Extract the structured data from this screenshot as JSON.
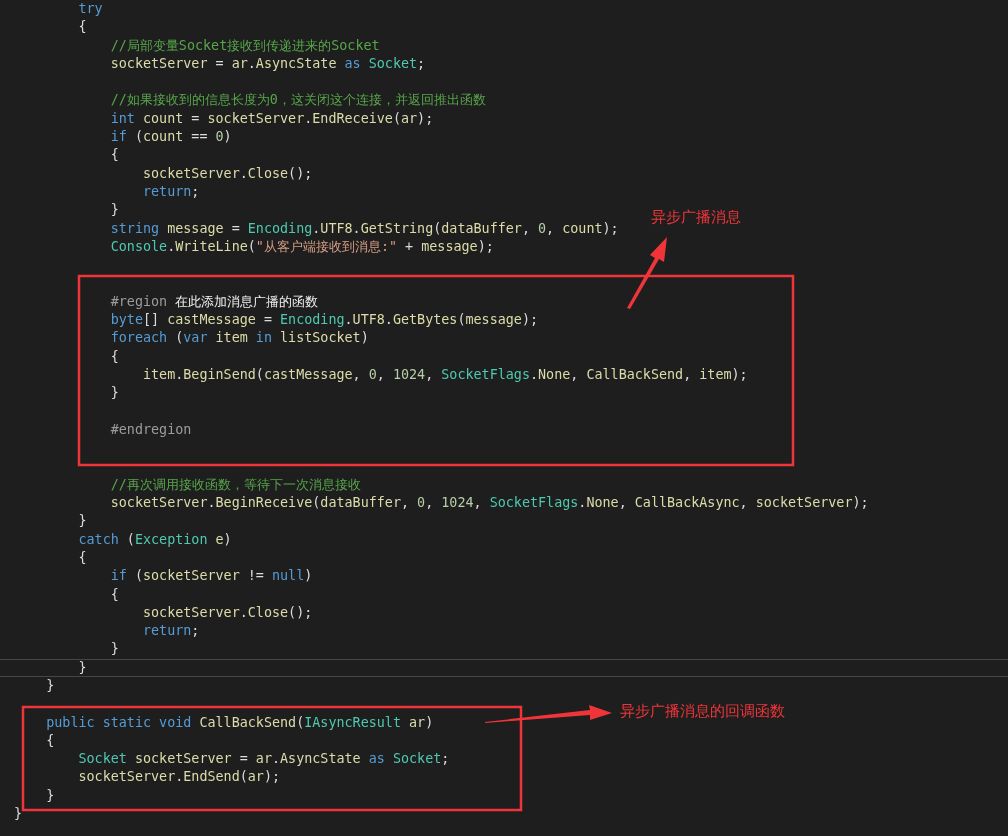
{
  "code_lines": [
    {
      "kind": "block",
      "children": [
        {
          "kind": "block",
          "children": [
            {
              "kind": "line",
              "current": false,
              "tokens": [
                {
                  "kind": "kw",
                  "text": "try"
                }
              ]
            },
            {
              "kind": "line",
              "current": false,
              "tokens": [
                {
                  "kind": "p",
                  "text": "{"
                }
              ]
            },
            {
              "kind": "block",
              "children": [
                {
                  "kind": "line",
                  "current": false,
                  "tokens": [
                    {
                      "kind": "com",
                      "text": "//局部变量Socket接收到传递进来的Socket"
                    }
                  ]
                },
                {
                  "kind": "line",
                  "current": false,
                  "tokens": [
                    {
                      "kind": "id",
                      "text": "socketServer"
                    },
                    {
                      "kind": "p",
                      "text": " = "
                    },
                    {
                      "kind": "id",
                      "text": "ar"
                    },
                    {
                      "kind": "p",
                      "text": "."
                    },
                    {
                      "kind": "id",
                      "text": "AsyncState"
                    },
                    {
                      "kind": "kw",
                      "text": " as "
                    },
                    {
                      "kind": "type",
                      "text": "Socket"
                    },
                    {
                      "kind": "p",
                      "text": ";"
                    }
                  ]
                },
                {
                  "kind": "blank"
                },
                {
                  "kind": "line",
                  "current": false,
                  "tokens": [
                    {
                      "kind": "com",
                      "text": "//如果接收到的信息长度为0，这关闭这个连接，并返回推出函数"
                    }
                  ]
                },
                {
                  "kind": "line",
                  "current": false,
                  "tokens": [
                    {
                      "kind": "kw",
                      "text": "int "
                    },
                    {
                      "kind": "id",
                      "text": "count"
                    },
                    {
                      "kind": "p",
                      "text": " = "
                    },
                    {
                      "kind": "id",
                      "text": "socketServer"
                    },
                    {
                      "kind": "p",
                      "text": "."
                    },
                    {
                      "kind": "id",
                      "text": "EndReceive"
                    },
                    {
                      "kind": "p",
                      "text": "("
                    },
                    {
                      "kind": "id",
                      "text": "ar"
                    },
                    {
                      "kind": "p",
                      "text": ");"
                    }
                  ]
                },
                {
                  "kind": "line",
                  "current": false,
                  "tokens": [
                    {
                      "kind": "kw",
                      "text": "if"
                    },
                    {
                      "kind": "p",
                      "text": " ("
                    },
                    {
                      "kind": "id",
                      "text": "count"
                    },
                    {
                      "kind": "p",
                      "text": " == "
                    },
                    {
                      "kind": "num",
                      "text": "0"
                    },
                    {
                      "kind": "p",
                      "text": ")"
                    }
                  ]
                },
                {
                  "kind": "line",
                  "current": false,
                  "tokens": [
                    {
                      "kind": "p",
                      "text": "{"
                    }
                  ]
                },
                {
                  "kind": "block",
                  "children": [
                    {
                      "kind": "line",
                      "current": false,
                      "tokens": [
                        {
                          "kind": "id",
                          "text": "socketServer"
                        },
                        {
                          "kind": "p",
                          "text": "."
                        },
                        {
                          "kind": "id",
                          "text": "Close"
                        },
                        {
                          "kind": "p",
                          "text": "();"
                        }
                      ]
                    },
                    {
                      "kind": "line",
                      "current": false,
                      "tokens": [
                        {
                          "kind": "kw",
                          "text": "return"
                        },
                        {
                          "kind": "p",
                          "text": ";"
                        }
                      ]
                    }
                  ]
                },
                {
                  "kind": "line",
                  "current": false,
                  "tokens": [
                    {
                      "kind": "p",
                      "text": "}"
                    }
                  ]
                },
                {
                  "kind": "line",
                  "current": false,
                  "tokens": [
                    {
                      "kind": "kw",
                      "text": "string "
                    },
                    {
                      "kind": "id",
                      "text": "message"
                    },
                    {
                      "kind": "p",
                      "text": " = "
                    },
                    {
                      "kind": "type",
                      "text": "Encoding"
                    },
                    {
                      "kind": "p",
                      "text": "."
                    },
                    {
                      "kind": "id",
                      "text": "UTF8"
                    },
                    {
                      "kind": "p",
                      "text": "."
                    },
                    {
                      "kind": "id",
                      "text": "GetString"
                    },
                    {
                      "kind": "p",
                      "text": "("
                    },
                    {
                      "kind": "id",
                      "text": "dataBuffer"
                    },
                    {
                      "kind": "p",
                      "text": ", "
                    },
                    {
                      "kind": "num",
                      "text": "0"
                    },
                    {
                      "kind": "p",
                      "text": ", "
                    },
                    {
                      "kind": "id",
                      "text": "count"
                    },
                    {
                      "kind": "p",
                      "text": ");"
                    }
                  ]
                },
                {
                  "kind": "line",
                  "current": false,
                  "tokens": [
                    {
                      "kind": "type",
                      "text": "Console"
                    },
                    {
                      "kind": "p",
                      "text": "."
                    },
                    {
                      "kind": "id",
                      "text": "WriteLine"
                    },
                    {
                      "kind": "p",
                      "text": "("
                    },
                    {
                      "kind": "str",
                      "text": "\"从客户端接收到消息:\""
                    },
                    {
                      "kind": "p",
                      "text": " + "
                    },
                    {
                      "kind": "id",
                      "text": "message"
                    },
                    {
                      "kind": "p",
                      "text": ");"
                    }
                  ]
                },
                {
                  "kind": "blank"
                },
                {
                  "kind": "blank"
                },
                {
                  "kind": "line",
                  "current": false,
                  "tokens": [
                    {
                      "kind": "dir",
                      "text": "#region "
                    },
                    {
                      "kind": "reg",
                      "text": "在此添加消息广播的函数"
                    }
                  ]
                },
                {
                  "kind": "line",
                  "current": false,
                  "tokens": [
                    {
                      "kind": "kw",
                      "text": "byte"
                    },
                    {
                      "kind": "p",
                      "text": "[] "
                    },
                    {
                      "kind": "id",
                      "text": "castMessage"
                    },
                    {
                      "kind": "p",
                      "text": " = "
                    },
                    {
                      "kind": "type",
                      "text": "Encoding"
                    },
                    {
                      "kind": "p",
                      "text": "."
                    },
                    {
                      "kind": "id",
                      "text": "UTF8"
                    },
                    {
                      "kind": "p",
                      "text": "."
                    },
                    {
                      "kind": "id",
                      "text": "GetBytes"
                    },
                    {
                      "kind": "p",
                      "text": "("
                    },
                    {
                      "kind": "id",
                      "text": "message"
                    },
                    {
                      "kind": "p",
                      "text": ");"
                    }
                  ]
                },
                {
                  "kind": "line",
                  "current": false,
                  "tokens": [
                    {
                      "kind": "kw",
                      "text": "foreach"
                    },
                    {
                      "kind": "p",
                      "text": " ("
                    },
                    {
                      "kind": "kw",
                      "text": "var "
                    },
                    {
                      "kind": "id",
                      "text": "item"
                    },
                    {
                      "kind": "kw",
                      "text": " in "
                    },
                    {
                      "kind": "id",
                      "text": "listSocket"
                    },
                    {
                      "kind": "p",
                      "text": ")"
                    }
                  ]
                },
                {
                  "kind": "line",
                  "current": false,
                  "tokens": [
                    {
                      "kind": "p",
                      "text": "{"
                    }
                  ]
                },
                {
                  "kind": "block",
                  "children": [
                    {
                      "kind": "line",
                      "current": false,
                      "tokens": [
                        {
                          "kind": "id",
                          "text": "item"
                        },
                        {
                          "kind": "p",
                          "text": "."
                        },
                        {
                          "kind": "id",
                          "text": "BeginSend"
                        },
                        {
                          "kind": "p",
                          "text": "("
                        },
                        {
                          "kind": "id",
                          "text": "castMessage"
                        },
                        {
                          "kind": "p",
                          "text": ", "
                        },
                        {
                          "kind": "num",
                          "text": "0"
                        },
                        {
                          "kind": "p",
                          "text": ", "
                        },
                        {
                          "kind": "num",
                          "text": "1024"
                        },
                        {
                          "kind": "p",
                          "text": ", "
                        },
                        {
                          "kind": "type",
                          "text": "SocketFlags"
                        },
                        {
                          "kind": "p",
                          "text": "."
                        },
                        {
                          "kind": "id",
                          "text": "None"
                        },
                        {
                          "kind": "p",
                          "text": ", "
                        },
                        {
                          "kind": "id",
                          "text": "CallBackSend"
                        },
                        {
                          "kind": "p",
                          "text": ", "
                        },
                        {
                          "kind": "id",
                          "text": "item"
                        },
                        {
                          "kind": "p",
                          "text": ");"
                        }
                      ]
                    }
                  ]
                },
                {
                  "kind": "line",
                  "current": false,
                  "tokens": [
                    {
                      "kind": "p",
                      "text": "}"
                    }
                  ]
                },
                {
                  "kind": "blank"
                },
                {
                  "kind": "line",
                  "current": false,
                  "tokens": [
                    {
                      "kind": "dir",
                      "text": "#endregion"
                    }
                  ]
                },
                {
                  "kind": "blank"
                },
                {
                  "kind": "blank"
                },
                {
                  "kind": "line",
                  "current": false,
                  "tokens": [
                    {
                      "kind": "com",
                      "text": "//再次调用接收函数，等待下一次消息接收"
                    }
                  ]
                },
                {
                  "kind": "line",
                  "current": false,
                  "tokens": [
                    {
                      "kind": "id",
                      "text": "socketServer"
                    },
                    {
                      "kind": "p",
                      "text": "."
                    },
                    {
                      "kind": "id",
                      "text": "BeginReceive"
                    },
                    {
                      "kind": "p",
                      "text": "("
                    },
                    {
                      "kind": "id",
                      "text": "dataBuffer"
                    },
                    {
                      "kind": "p",
                      "text": ", "
                    },
                    {
                      "kind": "num",
                      "text": "0"
                    },
                    {
                      "kind": "p",
                      "text": ", "
                    },
                    {
                      "kind": "num",
                      "text": "1024"
                    },
                    {
                      "kind": "p",
                      "text": ", "
                    },
                    {
                      "kind": "type",
                      "text": "SocketFlags"
                    },
                    {
                      "kind": "p",
                      "text": "."
                    },
                    {
                      "kind": "id",
                      "text": "None"
                    },
                    {
                      "kind": "p",
                      "text": ", "
                    },
                    {
                      "kind": "id",
                      "text": "CallBackAsync"
                    },
                    {
                      "kind": "p",
                      "text": ", "
                    },
                    {
                      "kind": "id",
                      "text": "socketServer"
                    },
                    {
                      "kind": "p",
                      "text": ");"
                    }
                  ]
                }
              ]
            },
            {
              "kind": "line",
              "current": false,
              "tokens": [
                {
                  "kind": "p",
                  "text": "}"
                }
              ]
            },
            {
              "kind": "line",
              "current": false,
              "tokens": [
                {
                  "kind": "kw",
                  "text": "catch"
                },
                {
                  "kind": "p",
                  "text": " ("
                },
                {
                  "kind": "type",
                  "text": "Exception"
                },
                {
                  "kind": "id",
                  "text": " e"
                },
                {
                  "kind": "p",
                  "text": ")"
                }
              ]
            },
            {
              "kind": "line",
              "current": false,
              "tokens": [
                {
                  "kind": "p",
                  "text": "{"
                }
              ]
            },
            {
              "kind": "block",
              "children": [
                {
                  "kind": "line",
                  "current": false,
                  "tokens": [
                    {
                      "kind": "kw",
                      "text": "if"
                    },
                    {
                      "kind": "p",
                      "text": " ("
                    },
                    {
                      "kind": "id",
                      "text": "socketServer"
                    },
                    {
                      "kind": "p",
                      "text": " != "
                    },
                    {
                      "kind": "kw",
                      "text": "null"
                    },
                    {
                      "kind": "p",
                      "text": ")"
                    }
                  ]
                },
                {
                  "kind": "line",
                  "current": false,
                  "tokens": [
                    {
                      "kind": "p",
                      "text": "{"
                    }
                  ]
                },
                {
                  "kind": "block",
                  "children": [
                    {
                      "kind": "line",
                      "current": false,
                      "tokens": [
                        {
                          "kind": "id",
                          "text": "socketServer"
                        },
                        {
                          "kind": "p",
                          "text": "."
                        },
                        {
                          "kind": "id",
                          "text": "Close"
                        },
                        {
                          "kind": "p",
                          "text": "();"
                        }
                      ]
                    },
                    {
                      "kind": "line",
                      "current": false,
                      "tokens": [
                        {
                          "kind": "kw",
                          "text": "return"
                        },
                        {
                          "kind": "p",
                          "text": ";"
                        }
                      ]
                    }
                  ]
                },
                {
                  "kind": "line",
                  "current": false,
                  "tokens": [
                    {
                      "kind": "p",
                      "text": "}"
                    }
                  ]
                }
              ]
            },
            {
              "kind": "line",
              "current": true,
              "tokens": [
                {
                  "kind": "p",
                  "text": "}"
                }
              ]
            }
          ]
        },
        {
          "kind": "line",
          "current": false,
          "tokens": [
            {
              "kind": "p",
              "text": "}"
            }
          ]
        },
        {
          "kind": "blank"
        },
        {
          "kind": "line",
          "current": false,
          "tokens": [
            {
              "kind": "kw",
              "text": "public static void "
            },
            {
              "kind": "id",
              "text": "CallBackSend"
            },
            {
              "kind": "p",
              "text": "("
            },
            {
              "kind": "type",
              "text": "IAsyncResult"
            },
            {
              "kind": "id",
              "text": " ar"
            },
            {
              "kind": "p",
              "text": ")"
            }
          ]
        },
        {
          "kind": "line",
          "current": false,
          "tokens": [
            {
              "kind": "p",
              "text": "{"
            }
          ]
        },
        {
          "kind": "block",
          "children": [
            {
              "kind": "line",
              "current": false,
              "tokens": [
                {
                  "kind": "type",
                  "text": "Socket "
                },
                {
                  "kind": "id",
                  "text": "socketServer"
                },
                {
                  "kind": "p",
                  "text": " = "
                },
                {
                  "kind": "id",
                  "text": "ar"
                },
                {
                  "kind": "p",
                  "text": "."
                },
                {
                  "kind": "id",
                  "text": "AsyncState"
                },
                {
                  "kind": "kw",
                  "text": " as "
                },
                {
                  "kind": "type",
                  "text": "Socket"
                },
                {
                  "kind": "p",
                  "text": ";"
                }
              ]
            },
            {
              "kind": "line",
              "current": false,
              "tokens": [
                {
                  "kind": "id",
                  "text": "socketServer"
                },
                {
                  "kind": "p",
                  "text": "."
                },
                {
                  "kind": "id",
                  "text": "EndSend"
                },
                {
                  "kind": "p",
                  "text": "("
                },
                {
                  "kind": "id",
                  "text": "ar"
                },
                {
                  "kind": "p",
                  "text": ");"
                }
              ]
            }
          ]
        },
        {
          "kind": "line",
          "current": false,
          "tokens": [
            {
              "kind": "p",
              "text": "}"
            }
          ]
        }
      ]
    },
    {
      "kind": "line",
      "current": false,
      "tokens": [
        {
          "kind": "p",
          "text": "}"
        }
      ]
    }
  ],
  "annotations": [
    {
      "text": "异步广播消息"
    },
    {
      "text": "异步广播消息的回调函数"
    }
  ]
}
